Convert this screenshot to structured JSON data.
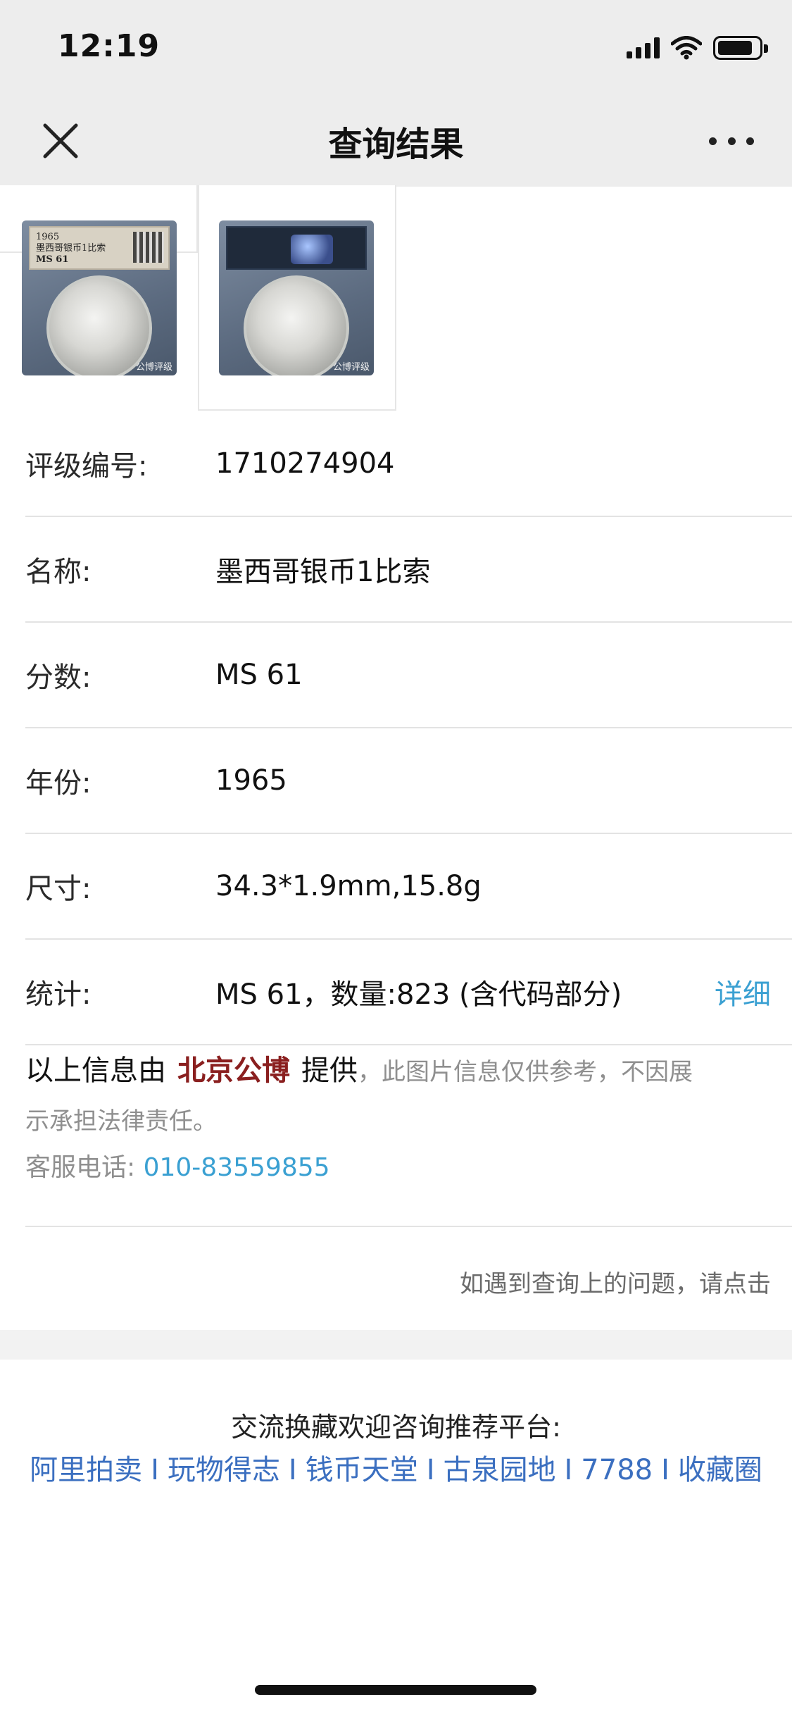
{
  "status_bar": {
    "time": "12:19"
  },
  "nav": {
    "title": "查询结果"
  },
  "thumbnails": {
    "coin1_label_top": "1965",
    "coin1_label_name": "墨西哥银币1比索",
    "coin1_label_grade": "MS 61",
    "watermark": "公博评级"
  },
  "rows": [
    {
      "label": "评级编号:",
      "value": "1710274904"
    },
    {
      "label": "名称:",
      "value": "墨西哥银币1比索"
    },
    {
      "label": "分数:",
      "value": "MS 61"
    },
    {
      "label": "年份:",
      "value": "1965"
    },
    {
      "label": "尺寸:",
      "value": "34.3*1.9mm,15.8g"
    },
    {
      "label": "统计:",
      "value": "MS 61，数量:823 (含代码部分)",
      "link": "详细"
    }
  ],
  "provider": {
    "prefix": "以上信息由",
    "brand": "北京公博",
    "suffix": "提供",
    "note_start": "，此图片信息仅供参考，不因展",
    "note_end": "示承担法律责任。",
    "phone_label": "客服电话:",
    "phone": "010-83559855"
  },
  "help_text": "如遇到查询上的问题，请点击",
  "footer": {
    "title": "交流换藏欢迎咨询推荐平台:",
    "platforms": [
      "阿里拍卖",
      "玩物得志",
      "钱币天堂",
      "古泉园地",
      "7788",
      "收藏圈"
    ],
    "separator": "I"
  },
  "colors": {
    "brand": "#8a1f1f",
    "link": "#3aa0d2",
    "platform_link": "#3b6fc0",
    "nav_bg": "#ededed"
  },
  "icons": [
    "close-icon",
    "more-icon",
    "signal-icon",
    "wifi-icon",
    "battery-icon"
  ]
}
